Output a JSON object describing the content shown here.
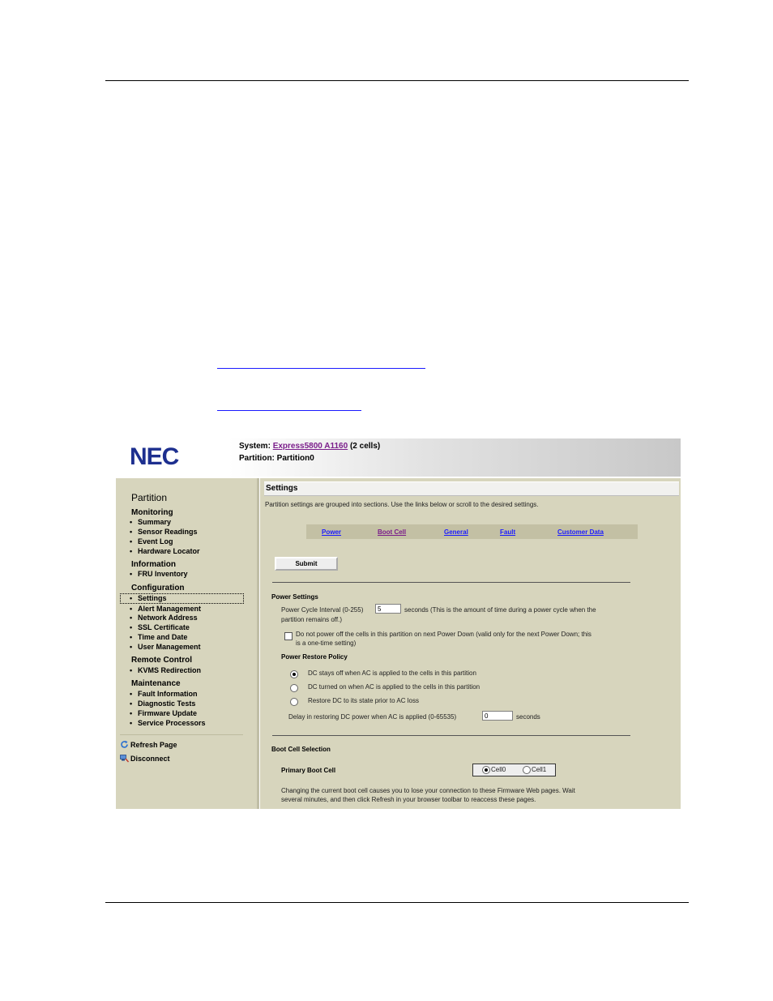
{
  "header": {
    "brand_logo": "NEC",
    "system_label": "System:",
    "system_name": "Express5800 A1160",
    "system_cells": "(2 cells)",
    "partition_line": "Partition: Partition0"
  },
  "sidebar": {
    "title": "Partition",
    "sections": [
      {
        "label": "Monitoring",
        "items": [
          "Summary",
          "Sensor Readings",
          "Event Log",
          "Hardware Locator"
        ]
      },
      {
        "label": "Information",
        "items": [
          "FRU Inventory"
        ]
      },
      {
        "label": "Configuration",
        "items": [
          "Settings",
          "Alert Management",
          "Network Address",
          "SSL Certificate",
          "Time and Date",
          "User Management"
        ]
      },
      {
        "label": "Remote Control",
        "items": [
          "KVMS Redirection"
        ]
      },
      {
        "label": "Maintenance",
        "items": [
          "Fault Information",
          "Diagnostic Tests",
          "Firmware Update",
          "Service Processors"
        ]
      }
    ],
    "selected_item": "Settings",
    "bullet": "•",
    "actions": {
      "refresh": {
        "label": "Refresh Page",
        "icon": "refresh-icon"
      },
      "disconnect": {
        "label": "Disconnect",
        "icon": "disconnect-icon"
      }
    }
  },
  "main": {
    "section_title": "Settings",
    "intro": "Partition settings are grouped into sections. Use the links below or scroll to the desired settings.",
    "nav_links": [
      "Power",
      "Boot Cell",
      "General",
      "Fault",
      "Customer Data"
    ],
    "submit_label": "Submit",
    "power": {
      "heading": "Power Settings",
      "cycle_label": "Power Cycle Interval (0-255)",
      "cycle_value": "5",
      "cycle_suffix_line1": "seconds (This is the amount of time during a power cycle when the",
      "cycle_suffix_line2": "partition remains off.)",
      "checkbox_line1": "Do not power off the cells in this partition on next Power Down (valid only for the next Power Down; this",
      "checkbox_line2": "is a one-time setting)",
      "checkbox_checked": false,
      "restore_heading": "Power Restore Policy",
      "restore_options": [
        "DC stays off when AC is applied to the cells in this partition",
        "DC turned on when AC is applied to the cells in this partition",
        "Restore DC to its state prior to AC loss"
      ],
      "restore_selected_index": 0,
      "delay_label": "Delay in restoring DC power when AC is applied (0-65535)",
      "delay_value": "0",
      "delay_suffix": "seconds"
    },
    "boot": {
      "heading": "Boot Cell Selection",
      "primary_label": "Primary Boot Cell",
      "options": [
        "Cell0",
        "Cell1"
      ],
      "selected_index": 0,
      "note_line1": "Changing the current boot cell causes you to lose your connection to these Firmware Web pages. Wait",
      "note_line2": "several minutes, and then click Refresh in your browser toolbar to reaccess these pages."
    }
  },
  "colors": {
    "panel_bg": "#d7d5bd",
    "nav_band": "#c3c0a4",
    "link": "#1a1aff",
    "visited_link": "#7a1d8a",
    "logo": "#1d2f8f"
  }
}
